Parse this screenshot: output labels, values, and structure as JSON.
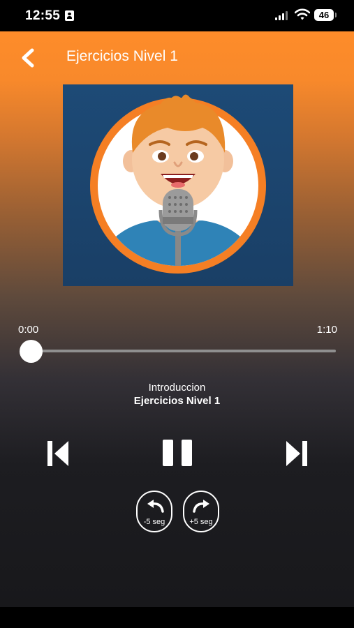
{
  "status_bar": {
    "time": "12:55",
    "battery": "46"
  },
  "header": {
    "title": "Ejercicios Nivel 1"
  },
  "player": {
    "elapsed": "0:00",
    "duration": "1:10",
    "progress": 0.0,
    "subtitle": "Introduccion",
    "title": "Ejercicios Nivel 1",
    "seek_back_label": "-5 seg",
    "seek_forward_label": "+5 seg"
  },
  "colors": {
    "gradient_top": "#fe8c2a",
    "gradient_bottom": "#18181b",
    "artwork_bg": "#1f4d7a",
    "artwork_ring": "#f57f24",
    "track": "#8f8f8f"
  }
}
